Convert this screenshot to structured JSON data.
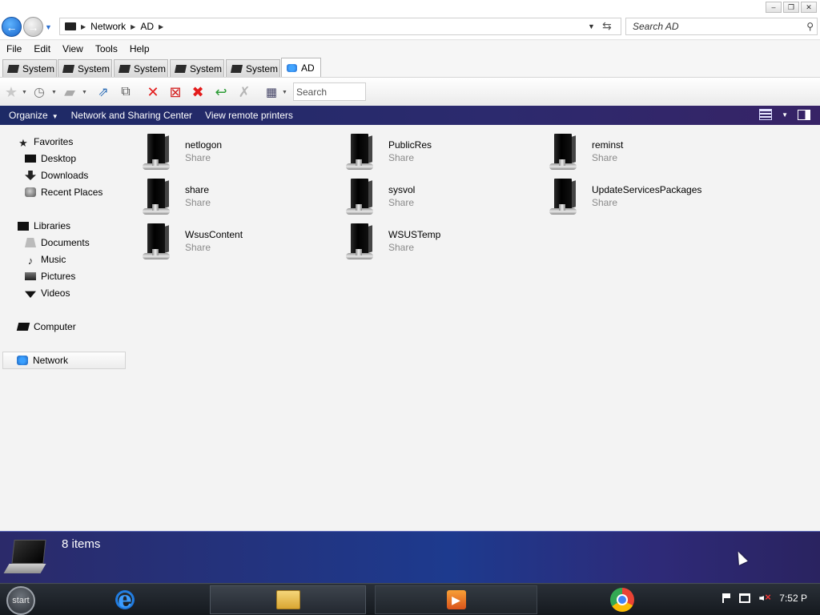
{
  "window": {
    "controls": [
      "–",
      "❐",
      "✕"
    ]
  },
  "address": {
    "segments": [
      "Network",
      "AD"
    ],
    "search_placeholder": "Search AD"
  },
  "menu": [
    "File",
    "Edit",
    "View",
    "Tools",
    "Help"
  ],
  "tabs": [
    {
      "label": "System",
      "active": false
    },
    {
      "label": "System",
      "active": false
    },
    {
      "label": "System",
      "active": false
    },
    {
      "label": "System",
      "active": false
    },
    {
      "label": "System",
      "active": false
    },
    {
      "label": "AD",
      "active": true
    }
  ],
  "toolbar": {
    "search_placeholder": "Search"
  },
  "command_bar": {
    "organize": "Organize",
    "network_sharing": "Network and Sharing Center",
    "remote_printers": "View remote printers"
  },
  "nav": {
    "favorites": "Favorites",
    "desktop": "Desktop",
    "downloads": "Downloads",
    "recent": "Recent Places",
    "libraries": "Libraries",
    "documents": "Documents",
    "music": "Music",
    "pictures": "Pictures",
    "videos": "Videos",
    "computer": "Computer",
    "network": "Network"
  },
  "items": [
    {
      "name": "netlogon",
      "type": "Share"
    },
    {
      "name": "PublicRes",
      "type": "Share"
    },
    {
      "name": "reminst",
      "type": "Share"
    },
    {
      "name": "share",
      "type": "Share"
    },
    {
      "name": "sysvol",
      "type": "Share"
    },
    {
      "name": "UpdateServicesPackages",
      "type": "Share"
    },
    {
      "name": "WsusContent",
      "type": "Share"
    },
    {
      "name": "WSUSTemp",
      "type": "Share"
    }
  ],
  "details": {
    "count": "8 items"
  },
  "taskbar": {
    "start": "start",
    "clock": "7:52 P"
  }
}
